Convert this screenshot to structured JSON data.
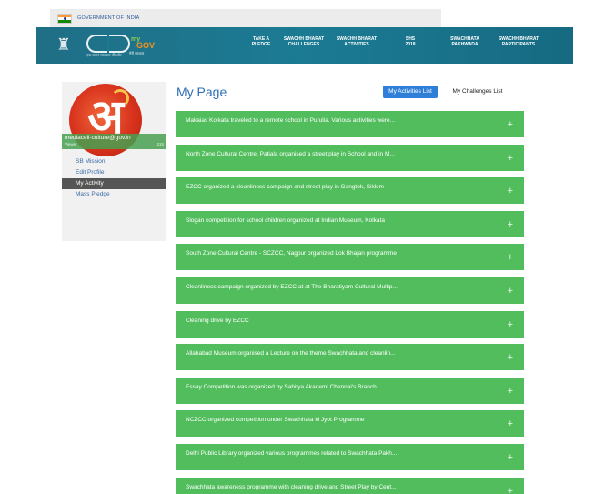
{
  "gov_strip": {
    "text": "GOVERNMENT OF INDIA"
  },
  "header": {
    "emblem_icon": "national-emblem-icon",
    "logo_tagline": "एक कदम स्वच्छता की ओर",
    "mygov": {
      "my": "my",
      "gov": "GOV",
      "sub": "मेरी सरकार"
    },
    "nav": [
      "TAKE A\nPLEDGE",
      "SWACHH BHARAT\nCHALLENGES",
      "SWACHH BHARAT\nACTIVITIES",
      "SHS\n2018",
      "SWACHHATA\nPAKHWADA",
      "SWACHH BHARAT\nPARTICIPANTS"
    ]
  },
  "sidebar": {
    "email": "mediacell-culture@gov.in",
    "email_sub": "Viewer",
    "email_count": "315",
    "menu": [
      "SB Mission",
      "Edit Profile",
      "My Activity",
      "Mass Pledge"
    ],
    "active_index": 2
  },
  "main": {
    "title": "My Page",
    "btn_activities": "My Activities List",
    "btn_challenges": "My Challenges List",
    "activities": [
      "Makaias Kolkata traveled to a remote school in Purulia. Various activities were...",
      "North Zone Cultural Centre, Patiala organised a street play in School and in M...",
      "EZCC organized a cleanliness campaign and street play in Gangtok, Sikkim",
      "Slogan competition for school children organized at Indian Museum, Kolkata",
      "South Zone Cultural Centre - SCZCC, Nagpur organized Lok Bhajan programme",
      "Cleanliness campaign organized by EZCC at at The Bharatiyam Cultural Multip...",
      "Cleaning drive by EZCC",
      "Allahabad Museum organised a Lecture on the theme Swachhata and cleanlin...",
      "Essay Competition was organized by Sahitya Akademi Chennai's Branch",
      "NCZCC organized competition under Swachhata ki Jyot Programme",
      "Delhi Public Library organized various programmes related to Swachhata Pakh...",
      "Swachhata awareness programme with cleaning drive and Street Play by Cent..."
    ],
    "plus_symbol": "+"
  },
  "colors": {
    "header": "#1b7b93",
    "activity_green": "#52bd5d",
    "primary_blue": "#2f7fd8",
    "title_blue": "#2f6fb6",
    "sidebar_active": "#555555"
  }
}
